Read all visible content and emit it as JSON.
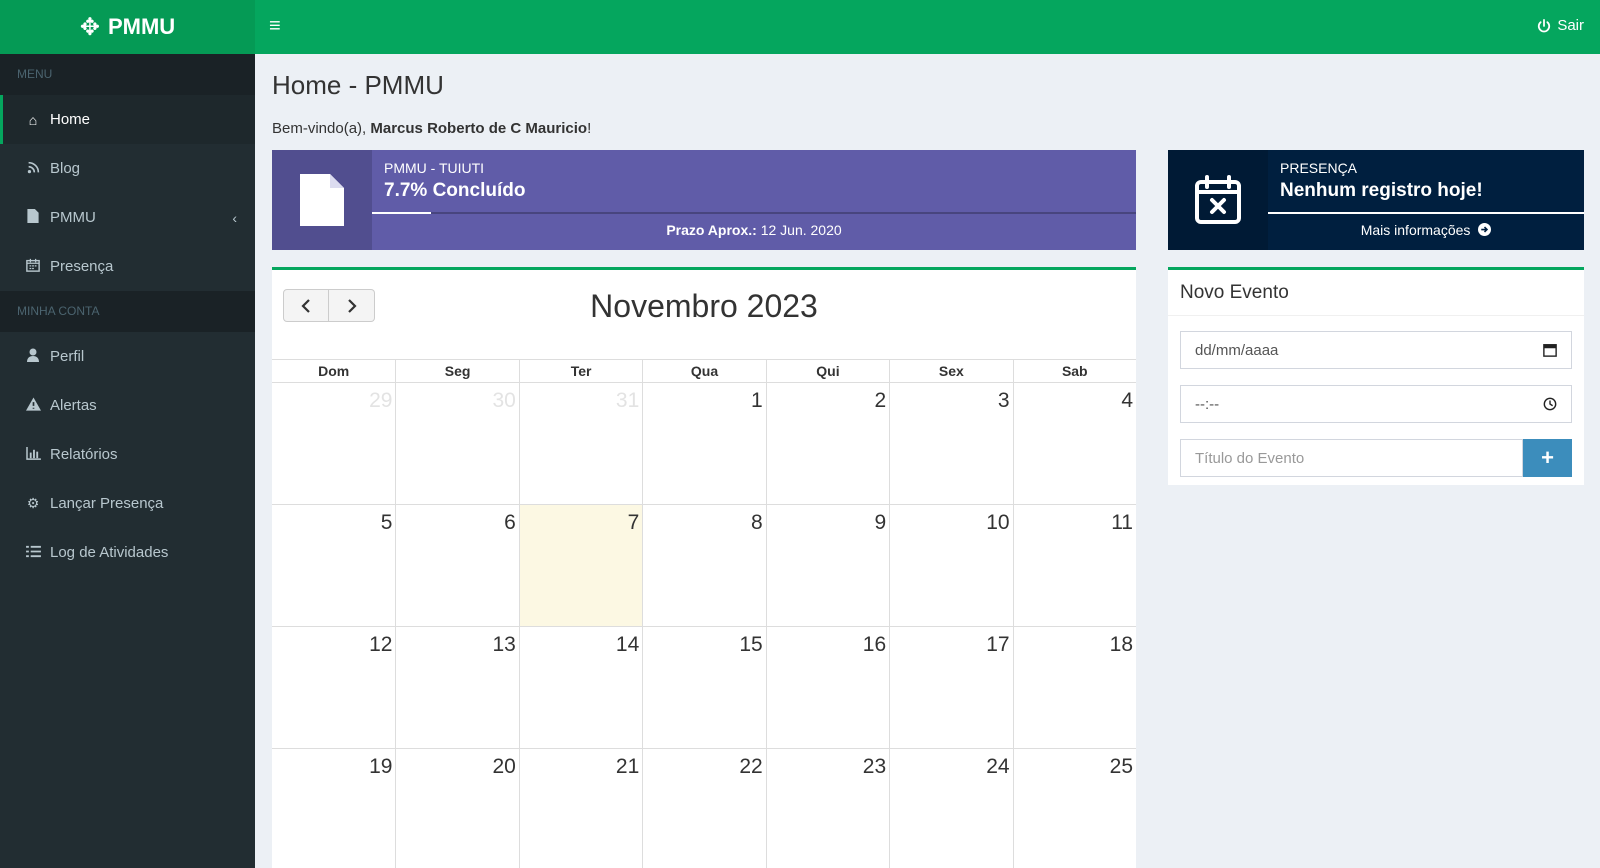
{
  "app": {
    "logo_text": "PMMU"
  },
  "topbar": {
    "logout_label": "Sair"
  },
  "sidebar": {
    "menu_header": "MENU",
    "account_header": "MINHA CONTA",
    "menu_items": [
      {
        "label": "Home",
        "icon": "home-icon",
        "active": true
      },
      {
        "label": "Blog",
        "icon": "rss-icon"
      },
      {
        "label": "PMMU",
        "icon": "file-icon",
        "has_submenu": true
      },
      {
        "label": "Presença",
        "icon": "calendar-icon"
      }
    ],
    "account_items": [
      {
        "label": "Perfil",
        "icon": "user-icon"
      },
      {
        "label": "Alertas",
        "icon": "warning-icon"
      },
      {
        "label": "Relatórios",
        "icon": "bar-chart-icon"
      },
      {
        "label": "Lançar Presença",
        "icon": "gear-icon"
      },
      {
        "label": "Log de Atividades",
        "icon": "list-icon"
      }
    ]
  },
  "page": {
    "title": "Home - PMMU",
    "welcome_prefix": "Bem-vindo(a),",
    "user_name": "Marcus Roberto de C Mauricio",
    "welcome_suffix": "!"
  },
  "progress_box": {
    "label": "PMMU - TUIUTI",
    "value": "7.7% Concluído",
    "progress_percent": 7.7,
    "deadline_label": "Prazo Aprox.:",
    "deadline_value": "12 Jun. 2020",
    "color": "#605ca8"
  },
  "presence_box": {
    "label": "PRESENÇA",
    "value": "Nenhum registro hoje!",
    "footer": "Mais informações",
    "color": "#001f3f"
  },
  "calendar": {
    "title": "Novembro 2023",
    "weekdays": [
      "Dom",
      "Seg",
      "Ter",
      "Qua",
      "Qui",
      "Sex",
      "Sab"
    ],
    "days": [
      {
        "n": "29",
        "other": true
      },
      {
        "n": "30",
        "other": true
      },
      {
        "n": "31",
        "other": true
      },
      {
        "n": "1"
      },
      {
        "n": "2"
      },
      {
        "n": "3"
      },
      {
        "n": "4"
      },
      {
        "n": "5"
      },
      {
        "n": "6"
      },
      {
        "n": "7",
        "today": true
      },
      {
        "n": "8"
      },
      {
        "n": "9"
      },
      {
        "n": "10"
      },
      {
        "n": "11"
      },
      {
        "n": "12"
      },
      {
        "n": "13"
      },
      {
        "n": "14"
      },
      {
        "n": "15"
      },
      {
        "n": "16"
      },
      {
        "n": "17"
      },
      {
        "n": "18"
      },
      {
        "n": "19"
      },
      {
        "n": "20"
      },
      {
        "n": "21"
      },
      {
        "n": "22"
      },
      {
        "n": "23"
      },
      {
        "n": "24"
      },
      {
        "n": "25"
      }
    ]
  },
  "new_event": {
    "title": "Novo Evento",
    "date_placeholder": "dd/mm/aaaa",
    "time_placeholder": "--:--",
    "title_placeholder": "Título do Evento",
    "add_symbol": "+"
  },
  "colors": {
    "accent": "#05a65e",
    "sidebar_bg": "#222d32",
    "today_bg": "#fcf8e3",
    "add_button": "#3c8dbc"
  }
}
